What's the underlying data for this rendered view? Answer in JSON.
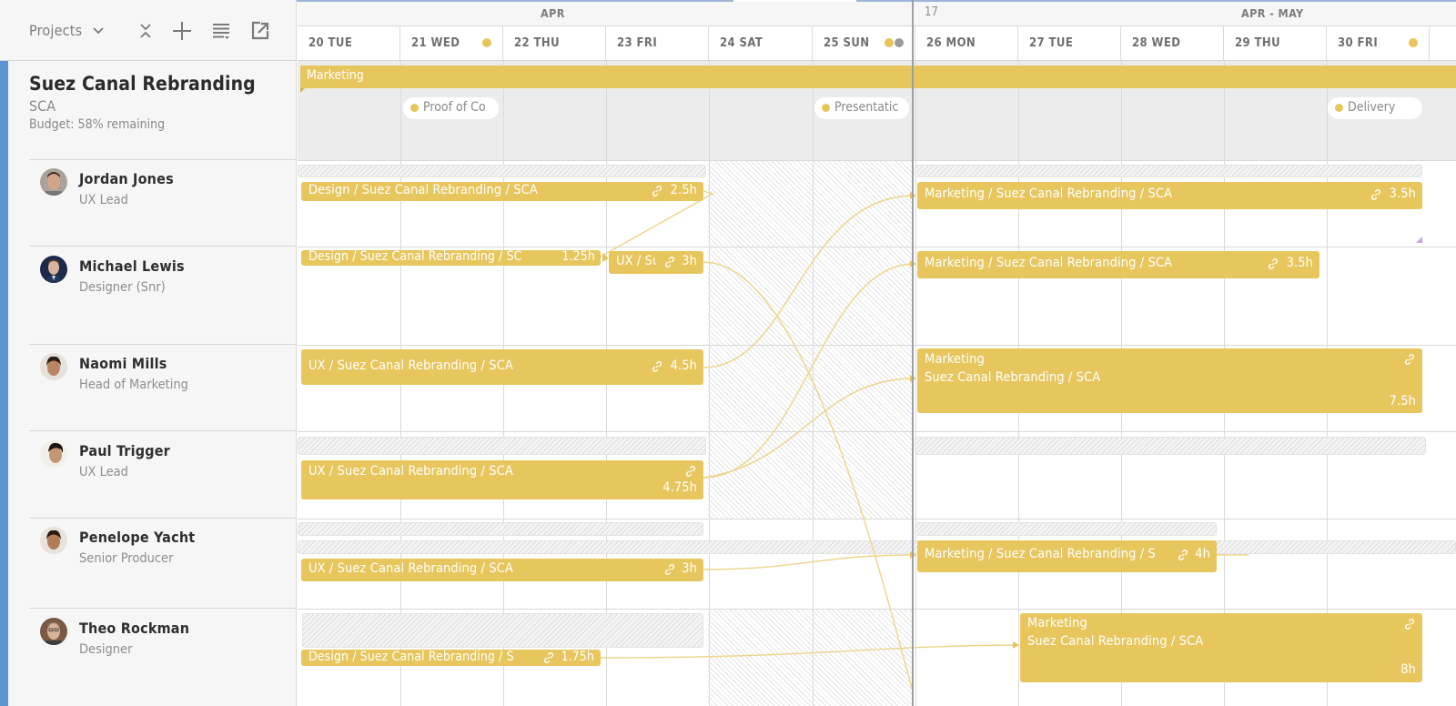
{
  "toolbar": {
    "projects_label": "Projects",
    "icons": [
      "chevron-down-icon",
      "collapse-icon",
      "add-icon",
      "filter-list-icon",
      "open-external-icon"
    ]
  },
  "project": {
    "title": "Suez Canal Rebranding",
    "code": "SCA",
    "budget": "Budget: 58% remaining",
    "accent_color": "#5b93d3",
    "banner_label": "Marketing",
    "milestones": [
      {
        "label": "Proof of Co",
        "day": "21 WED"
      },
      {
        "label": "Presentatic",
        "day": "25 SUN"
      },
      {
        "label": "Delivery",
        "day": "30 FRI"
      }
    ]
  },
  "header": {
    "month_left": "APR",
    "week_number": "17",
    "month_right": "APR - MAY",
    "days": [
      {
        "label": "20 TUE",
        "dots": []
      },
      {
        "label": "21 WED",
        "dots": [
          "yellow"
        ]
      },
      {
        "label": "22 THU",
        "dots": []
      },
      {
        "label": "23 FRI",
        "dots": []
      },
      {
        "label": "24 SAT",
        "dots": []
      },
      {
        "label": "25 SUN",
        "dots": [
          "yellow",
          "gray"
        ]
      },
      {
        "label": "26 MON",
        "dots": []
      },
      {
        "label": "27 TUE",
        "dots": []
      },
      {
        "label": "28 WED",
        "dots": []
      },
      {
        "label": "29 THU",
        "dots": []
      },
      {
        "label": "30 FRI",
        "dots": [
          "yellow"
        ]
      }
    ]
  },
  "people": [
    {
      "name": "Jordan Jones",
      "role": "UX Lead"
    },
    {
      "name": "Michael Lewis",
      "role": "Designer (Snr)"
    },
    {
      "name": "Naomi Mills",
      "role": "Head of Marketing"
    },
    {
      "name": "Paul Trigger",
      "role": "UX Lead"
    },
    {
      "name": "Penelope Yacht",
      "role": "Senior Producer"
    },
    {
      "name": "Theo Rockman",
      "role": "Designer"
    }
  ],
  "assignments": [
    {
      "person": "Jordan Jones",
      "label": "Design / Suez Canal Rebranding / SCA",
      "hours": "2.5h",
      "linked": true
    },
    {
      "person": "Jordan Jones",
      "label": "Marketing / Suez Canal Rebranding / SCA",
      "hours": "3.5h",
      "linked": true
    },
    {
      "person": "Michael Lewis",
      "label": "Design / Suez Canal Rebranding / SC",
      "hours": "1.25h",
      "linked": false
    },
    {
      "person": "Michael Lewis",
      "label": "UX / Su",
      "hours": "3h",
      "linked": true
    },
    {
      "person": "Michael Lewis",
      "label": "Marketing / Suez Canal Rebranding / SCA",
      "hours": "3.5h",
      "linked": true
    },
    {
      "person": "Naomi Mills",
      "label": "UX / Suez Canal Rebranding / SCA",
      "hours": "4.5h",
      "linked": true
    },
    {
      "person": "Naomi Mills",
      "label_line1": "Marketing",
      "label_line2": "Suez Canal Rebranding / SCA",
      "hours": "7.5h",
      "linked": true
    },
    {
      "person": "Paul Trigger",
      "label": "UX / Suez Canal Rebranding / SCA",
      "hours": "4.75h",
      "linked": true
    },
    {
      "person": "Penelope Yacht",
      "label": "UX / Suez Canal Rebranding / SCA",
      "hours": "3h",
      "linked": true
    },
    {
      "person": "Penelope Yacht",
      "label": "Marketing / Suez Canal Rebranding / S",
      "hours": "4h",
      "linked": true
    },
    {
      "person": "Theo Rockman",
      "label": "Design / Suez Canal Rebranding / S",
      "hours": "1.75h",
      "linked": true
    },
    {
      "person": "Theo Rockman",
      "label_line1": "Marketing",
      "label_line2": "Suez Canal Rebranding / SCA",
      "hours": "8h",
      "linked": true
    }
  ],
  "colors": {
    "bar": "#e7c65e",
    "milestone_dot": "#e8c55a",
    "accent": "#5b93d3"
  }
}
